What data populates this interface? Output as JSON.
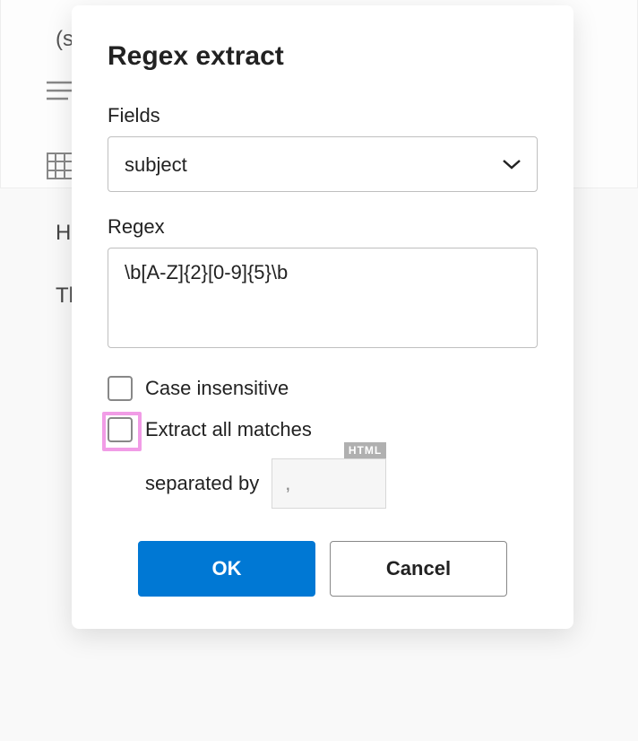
{
  "background": {
    "text_s": "(s",
    "text_hel": "Hel",
    "text_tha": "Tha"
  },
  "modal": {
    "title": "Regex extract",
    "fields_label": "Fields",
    "fields_value": "subject",
    "regex_label": "Regex",
    "regex_value": "\\b[A-Z]{2}[0-9]{5}\\b",
    "case_insensitive_label": "Case insensitive",
    "case_insensitive_checked": false,
    "extract_all_label": "Extract all matches",
    "extract_all_checked": false,
    "separated_by_label": "separated by",
    "separator_value": ",",
    "html_badge": "HTML",
    "ok_label": "OK",
    "cancel_label": "Cancel"
  }
}
